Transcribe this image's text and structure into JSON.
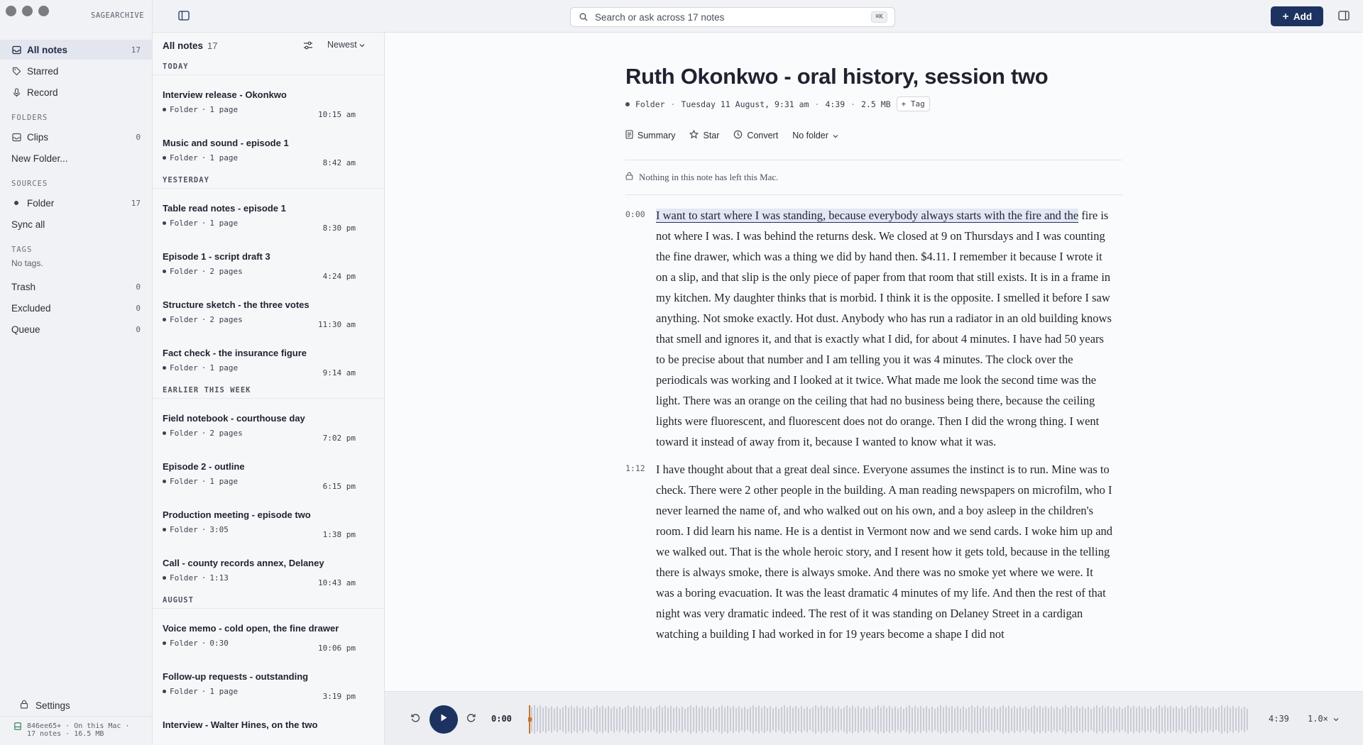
{
  "app": {
    "brand": "SAGEARCHIVE"
  },
  "sidebar": {
    "all_notes": {
      "label": "All notes",
      "count": "17"
    },
    "starred": "Starred",
    "record": "Record",
    "folders_heading": "FOLDERS",
    "clips": {
      "label": "Clips",
      "count": "0"
    },
    "new_folder": "New Folder...",
    "sources_heading": "SOURCES",
    "folder_source": {
      "label": "Folder",
      "count": "17"
    },
    "sync_all": "Sync all",
    "tags_heading": "TAGS",
    "no_tags": "No tags.",
    "trash": {
      "label": "Trash",
      "count": "0"
    },
    "excluded": {
      "label": "Excluded",
      "count": "0"
    },
    "queue": {
      "label": "Queue",
      "count": "0"
    },
    "settings": "Settings",
    "status_line1": "846ee65+ · On this Mac ·",
    "status_line2": "17 notes · 16.5 MB"
  },
  "topbar": {
    "search_placeholder": "Search or ask across 17 notes",
    "search_shortcut": "⌘K",
    "add_label": "Add"
  },
  "list": {
    "title": "All notes",
    "count": "17",
    "sort": "Newest",
    "groups": [
      {
        "heading": "TODAY",
        "notes": [
          {
            "title": "Interview release - Okonkwo",
            "source": "Folder",
            "detail": "1 page",
            "time": "10:15 am"
          },
          {
            "title": "Music and sound - episode 1",
            "source": "Folder",
            "detail": "1 page",
            "time": "8:42 am"
          }
        ]
      },
      {
        "heading": "YESTERDAY",
        "notes": [
          {
            "title": "Table read notes - episode 1",
            "source": "Folder",
            "detail": "1 page",
            "time": "8:30 pm"
          },
          {
            "title": "Episode 1 - script draft 3",
            "source": "Folder",
            "detail": "2 pages",
            "time": "4:24 pm"
          },
          {
            "title": "Structure sketch - the three votes",
            "source": "Folder",
            "detail": "2 pages",
            "time": "11:30 am"
          },
          {
            "title": "Fact check - the insurance figure",
            "source": "Folder",
            "detail": "1 page",
            "time": "9:14 am"
          }
        ]
      },
      {
        "heading": "EARLIER THIS WEEK",
        "notes": [
          {
            "title": "Field notebook - courthouse day",
            "source": "Folder",
            "detail": "2 pages",
            "time": "7:02 pm"
          },
          {
            "title": "Episode 2 - outline",
            "source": "Folder",
            "detail": "1 page",
            "time": "6:15 pm"
          },
          {
            "title": "Production meeting - episode two",
            "source": "Folder",
            "detail": "3:05",
            "time": "1:38 pm"
          },
          {
            "title": "Call - county records annex, Delaney",
            "source": "Folder",
            "detail": "1:13",
            "time": "10:43 am"
          }
        ]
      },
      {
        "heading": "AUGUST",
        "notes": [
          {
            "title": "Voice memo - cold open, the fine drawer",
            "source": "Folder",
            "detail": "0:30",
            "time": "10:06 pm"
          },
          {
            "title": "Follow-up requests - outstanding",
            "source": "Folder",
            "detail": "1 page",
            "time": "3:19 pm"
          },
          {
            "title": "Interview - Walter Hines, on the two",
            "source": "",
            "detail": "",
            "time": ""
          }
        ]
      }
    ]
  },
  "doc": {
    "title": "Ruth Okonkwo - oral history, session two",
    "source": "Folder",
    "date": "Tuesday 11 August, 9:31 am",
    "duration": "4:39",
    "size": "2.5 MB",
    "tag_button": "+ Tag",
    "actions": {
      "summary": "Summary",
      "star": "Star",
      "convert": "Convert",
      "folder": "No folder"
    },
    "privacy": "Nothing in this note has left this Mac.",
    "segments": [
      {
        "ts": "0:00",
        "highlight": "I want to start where I was standing, because everybody always starts with the fire and the",
        "text": " fire is not where I was. I was behind the returns desk. We closed at 9 on Thursdays and I was counting the fine drawer, which was a thing we did by hand then. $4.11. I remember it because I wrote it on a slip, and that slip is the only piece of paper from that room that still exists. It is in a frame in my kitchen. My daughter thinks that is morbid. I think it is the opposite. I smelled it before I saw anything. Not smoke exactly. Hot dust. Anybody who has run a radiator in an old building knows that smell and ignores it, and that is exactly what I did, for about 4 minutes. I have had 50 years to be precise about that number and I am telling you it was 4 minutes. The clock over the periodicals was working and I looked at it twice. What made me look the second time was the light. There was an orange on the ceiling that had no business being there, because the ceiling lights were fluorescent, and fluorescent does not do orange. Then I did the wrong thing. I went toward it instead of away from it, because I wanted to know what it was."
      },
      {
        "ts": "1:12",
        "highlight": "",
        "text": "I have thought about that a great deal since. Everyone assumes the instinct is to run. Mine was to check. There were 2 other people in the building. A man reading newspapers on microfilm, who I never learned the name of, and who walked out on his own, and a boy asleep in the children's room. I did learn his name. He is a dentist in Vermont now and we send cards. I woke him up and we walked out. That is the whole heroic story, and I resent how it gets told, because in the telling there is always smoke, there is always smoke. And there was no smoke yet where we were. It was a boring evacuation. It was the least dramatic 4 minutes of my life. And then the rest of that night was very dramatic indeed. The rest of it was standing on Delaney Street in a cardigan watching a building I had worked in for 19 years become a shape I did not"
      }
    ]
  },
  "player": {
    "current": "0:00",
    "duration": "4:39",
    "speed": "1.0×",
    "progress": 0.0
  },
  "colors": {
    "accent": "#1e3261",
    "highlight": "#e1e7f5",
    "playhead": "#c8742f"
  }
}
